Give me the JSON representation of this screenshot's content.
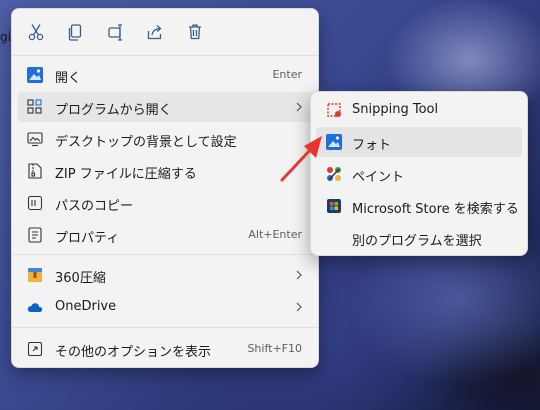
{
  "desktop": {
    "fragment_text": "gi"
  },
  "toolbar": [
    {
      "icon": "scissors-icon",
      "name": "cut-button"
    },
    {
      "icon": "copy-icon",
      "name": "copy-button"
    },
    {
      "icon": "rename-icon",
      "name": "rename-button"
    },
    {
      "icon": "share-icon",
      "name": "share-button"
    },
    {
      "icon": "trash-icon",
      "name": "delete-button"
    }
  ],
  "menu": {
    "open": {
      "label": "開く",
      "shortcut": "Enter",
      "icon": "photos-icon"
    },
    "open_with": {
      "label": "プログラムから開く",
      "icon": "open-with-icon"
    },
    "set_background": {
      "label": "デスクトップの背景として設定",
      "icon": "wallpaper-icon"
    },
    "zip": {
      "label": "ZIP ファイルに圧縮する",
      "icon": "zip-icon"
    },
    "copy_path": {
      "label": "パスのコピー",
      "icon": "copy-path-icon"
    },
    "properties": {
      "label": "プロパティ",
      "shortcut": "Alt+Enter",
      "icon": "properties-icon"
    },
    "compress_360": {
      "label": "360圧縮",
      "icon": "archive-360-icon"
    },
    "onedrive": {
      "label": "OneDrive",
      "icon": "cloud-icon"
    },
    "more_options": {
      "label": "その他のオプションを表示",
      "shortcut": "Shift+F10",
      "icon": "more-options-icon"
    }
  },
  "submenu": {
    "snipping": {
      "label": "Snipping Tool",
      "icon": "snipping-tool-icon"
    },
    "photos": {
      "label": "フォト",
      "icon": "photos-icon"
    },
    "paint": {
      "label": "ペイント",
      "icon": "paint-icon"
    },
    "store": {
      "label": "Microsoft Store を検索する",
      "icon": "store-icon"
    },
    "choose_other": {
      "label": "別のプログラムを選択"
    }
  },
  "colors": {
    "annotation_arrow": "#e8362f",
    "accent": "#0a64c8",
    "menu_bg": "#f3f3f3"
  }
}
